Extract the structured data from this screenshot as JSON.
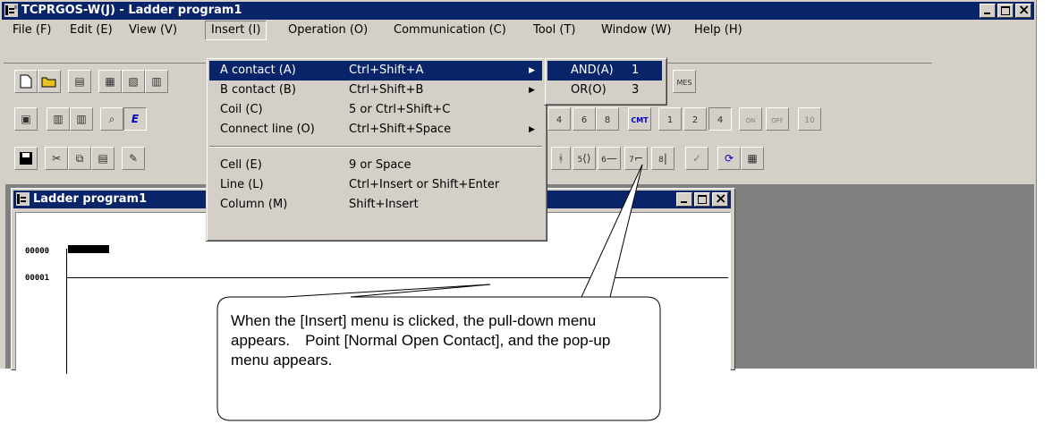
{
  "app": {
    "title": "TCPRGOS-W(J) - Ladder program1"
  },
  "menubar": [
    {
      "label": "File (F)"
    },
    {
      "label": "Edit (E)"
    },
    {
      "label": "View (V)"
    },
    {
      "label": "Insert (I)"
    },
    {
      "label": "Operation (O)"
    },
    {
      "label": "Communication (C)"
    },
    {
      "label": "Tool (T)"
    },
    {
      "label": "Window (W)"
    },
    {
      "label": "Help (H)"
    }
  ],
  "insert_menu": [
    {
      "label": "A contact (A)",
      "accel": "Ctrl+Shift+A"
    },
    {
      "label": "B contact (B)",
      "accel": "Ctrl+Shift+B"
    },
    {
      "label": "Coil (C)",
      "accel": "5 or Ctrl+Shift+C"
    },
    {
      "label": "Connect line (O)",
      "accel": "Ctrl+Shift+Space"
    },
    {
      "label": "Cell (E)",
      "accel": "9 or Space"
    },
    {
      "label": "Line (L)",
      "accel": "Ctrl+Insert or Shift+Enter"
    },
    {
      "label": "Column (M)",
      "accel": "Shift+Insert"
    }
  ],
  "submenu": [
    {
      "label": "AND(A)",
      "accel": "1"
    },
    {
      "label": "OR(O)",
      "accel": "3"
    }
  ],
  "toolbar": {
    "row2_labels": [
      "4",
      "6",
      "8",
      "CMT",
      "1",
      "2",
      "4",
      "ON",
      "OFF",
      "10"
    ],
    "row3_labels": [
      "5",
      "6",
      "7",
      "8"
    ],
    "mes_label": "MES"
  },
  "child_window": {
    "title": "Ladder program1",
    "lines": [
      "00000",
      "00001"
    ]
  },
  "callout": {
    "text": "When the [Insert] menu is clicked, the pull-down menu appears.　Point [Normal Open Contact], and the pop-up menu appears."
  },
  "colors": {
    "titlebar": "#0a246a",
    "face": "#d4d0c8",
    "highlight": "#0a246a",
    "mdi_background": "#808080"
  }
}
